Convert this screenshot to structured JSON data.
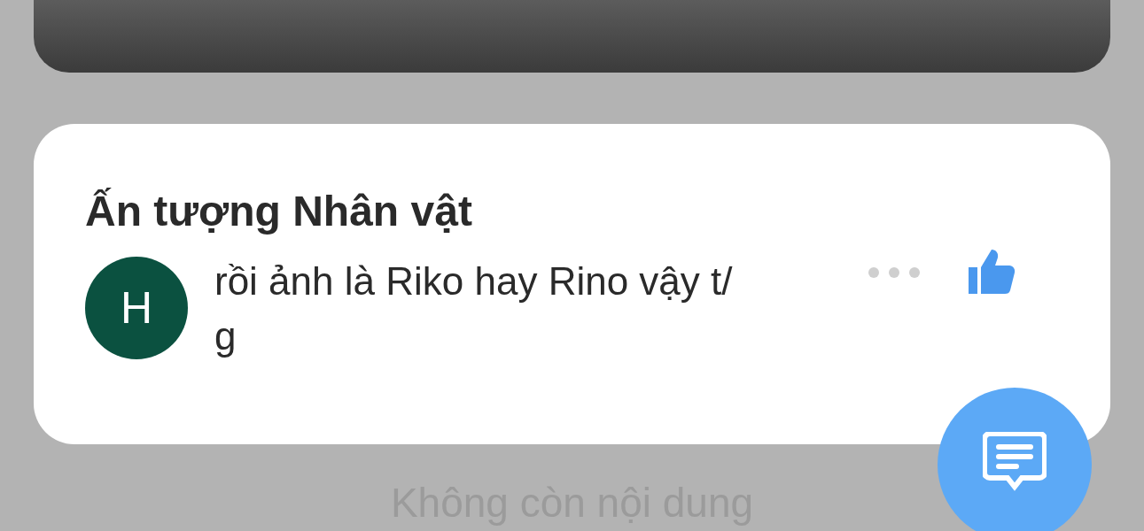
{
  "section": {
    "title": "Ấn tượng Nhân vật"
  },
  "comments": [
    {
      "avatar_letter": "H",
      "text": "rồi ảnh là Riko hay Rino vậy t/g",
      "liked": true
    }
  ],
  "footer_text": "Không còn nội dung"
}
